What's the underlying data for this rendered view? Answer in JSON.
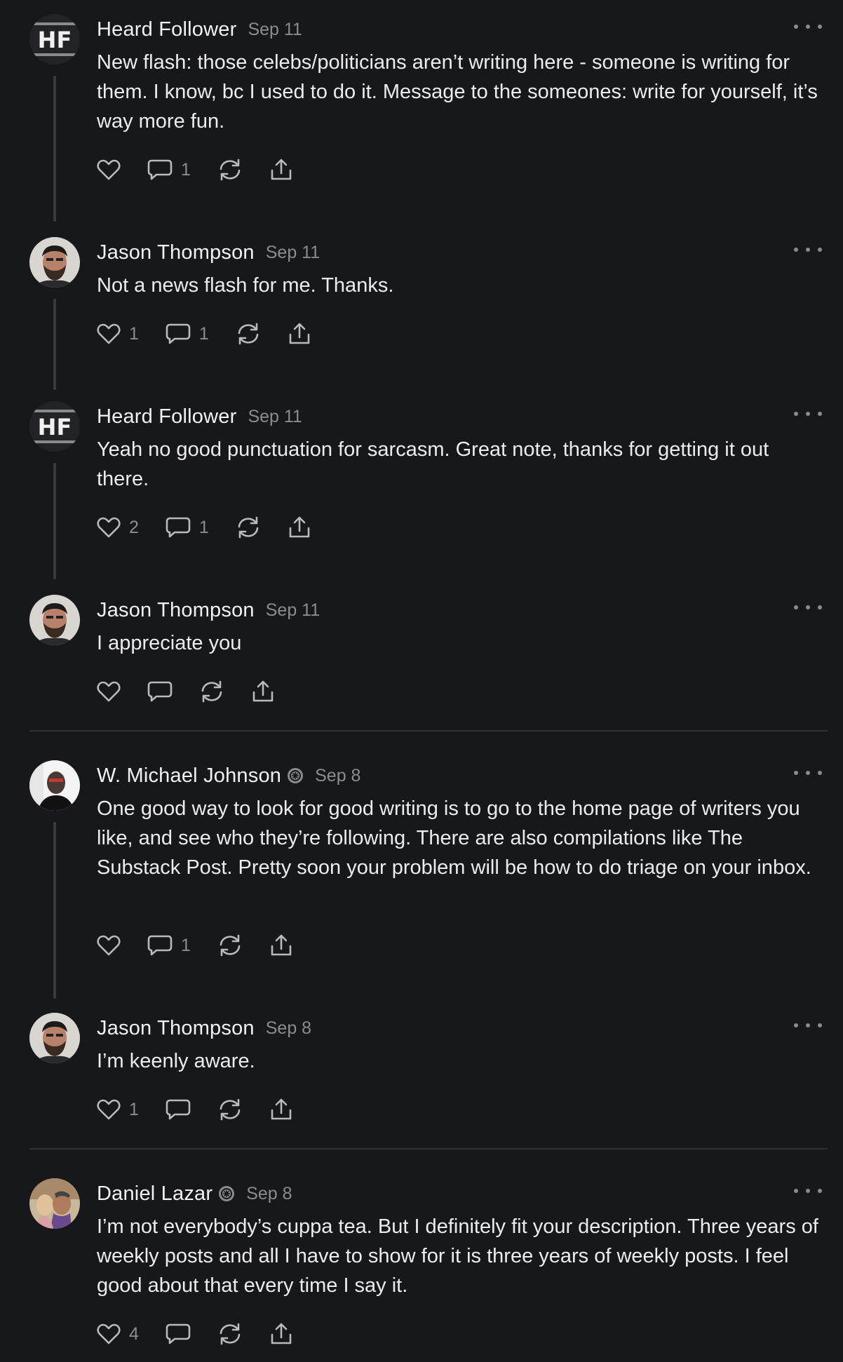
{
  "comments": [
    {
      "author": "Heard Follower",
      "date": "Sep 11",
      "text": "New flash: those celebs/politicians aren’t writing here - someone is writing for them. I know, bc I used to do it. Message to the someones: write for yourself, it’s way more fun.",
      "likes": "",
      "replies": "1",
      "avatar": "hf-logo"
    },
    {
      "author": "Jason Thompson",
      "date": "Sep 11",
      "text": "Not a news flash for me. Thanks.",
      "likes": "1",
      "replies": "1",
      "avatar": "jason-photo"
    },
    {
      "author": "Heard Follower",
      "date": "Sep 11",
      "text": "Yeah no good punctuation for sarcasm. Great note, thanks for getting it out there.",
      "likes": "2",
      "replies": "1",
      "avatar": "hf-logo"
    },
    {
      "author": "Jason Thompson",
      "date": "Sep 11",
      "text": "I appreciate you",
      "likes": "",
      "replies": "",
      "avatar": "jason-photo"
    },
    {
      "author": "W. Michael Johnson",
      "date": "Sep 8",
      "text": "One good way to look for good writing is to go to the home page of writers you like, and see who they’re following. There are also compilations like The Substack Post. Pretty soon your problem will be how to do triage on your inbox.",
      "likes": "",
      "replies": "1",
      "avatar": "michael-photo",
      "badge": "subscriber-badge-icon"
    },
    {
      "author": "Jason Thompson",
      "date": "Sep 8",
      "text": "I’m keenly aware.",
      "likes": "1",
      "replies": "",
      "avatar": "jason-photo"
    },
    {
      "author": "Daniel Lazar",
      "date": "Sep 8",
      "text": "I’m not everybody’s cuppa tea. But I definitely fit your description. Three years of weekly posts and all I have to show for it is three years of weekly posts. I feel good about that every time I say it.",
      "likes": "4",
      "replies": "",
      "avatar": "daniel-photo",
      "badge": "subscriber-badge-icon"
    }
  ],
  "colors": {
    "background": "#17181b",
    "text": "#ececee",
    "muted": "#8b8c91",
    "icon": "#b9babe",
    "thread_line": "#3a3b3f",
    "divider": "#2f3034"
  },
  "icons": {
    "like": "heart-icon",
    "reply": "comment-bubble-icon",
    "restack": "restack-icon",
    "share": "share-icon",
    "more": "more-dots-icon"
  }
}
